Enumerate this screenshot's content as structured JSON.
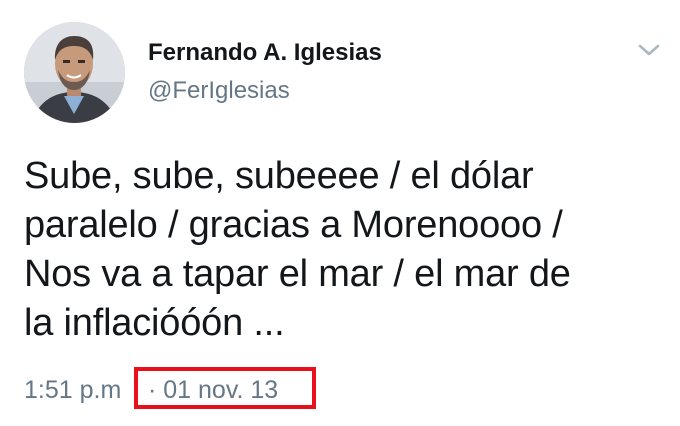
{
  "tweet": {
    "author": {
      "display_name": "Fernando A. Iglesias",
      "handle": "@FerIglesias",
      "avatar_icon": "profile-photo"
    },
    "menu_icon": "chevron-down-icon",
    "text": "Sube, sube, subeeee / el dólar\nparalelo / gracias a Morenoooo /\nNos va a tapar el mar / el mar de\nla inflacióóón ...",
    "time": "1:51 p.m",
    "date": "· 01 nov. 13"
  },
  "colors": {
    "text_primary": "#14171a",
    "text_secondary": "#657786",
    "highlight_box": "#e8101a"
  }
}
